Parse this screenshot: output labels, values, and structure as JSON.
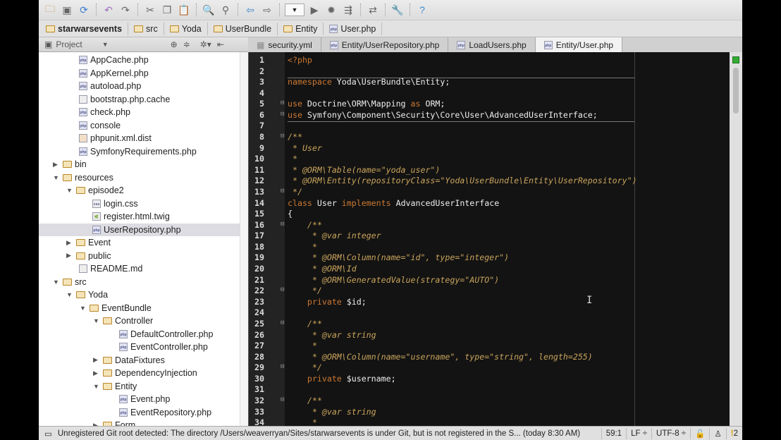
{
  "toolbar": {
    "icons": [
      "open-folder-icon",
      "save-icon",
      "sync-icon",
      "undo-icon",
      "redo-icon",
      "cut-icon",
      "copy-icon",
      "paste-icon",
      "find-icon",
      "replace-icon",
      "back-icon",
      "forward-icon",
      "run-config-dropdown",
      "run-icon",
      "debug-icon",
      "coverage-icon",
      "vcs-icon",
      "settings-icon",
      "help-icon"
    ]
  },
  "breadcrumb": [
    "starwarsevents",
    "src",
    "Yoda",
    "UserBundle",
    "Entity",
    "User.php"
  ],
  "project_panel": {
    "title": "Project"
  },
  "tabs": [
    {
      "label": "security.yml",
      "active": false
    },
    {
      "label": "Entity/UserRepository.php",
      "active": false
    },
    {
      "label": "LoadUsers.php",
      "active": false
    },
    {
      "label": "Entity/User.php",
      "active": true
    }
  ],
  "tree": [
    {
      "label": "AppCache.php",
      "level": 1,
      "type": "php"
    },
    {
      "label": "AppKernel.php",
      "level": 1,
      "type": "php"
    },
    {
      "label": "autoload.php",
      "level": 1,
      "type": "php"
    },
    {
      "label": "bootstrap.php.cache",
      "level": 1,
      "type": "file"
    },
    {
      "label": "check.php",
      "level": 1,
      "type": "php"
    },
    {
      "label": "console",
      "level": 1,
      "type": "php"
    },
    {
      "label": "phpunit.xml.dist",
      "level": 1,
      "type": "xml"
    },
    {
      "label": "SymfonyRequirements.php",
      "level": 1,
      "type": "php"
    },
    {
      "label": "bin",
      "level": 0,
      "type": "folder",
      "expanded": false
    },
    {
      "label": "resources",
      "level": 0,
      "type": "folder",
      "expanded": true
    },
    {
      "label": "episode2",
      "level": 1,
      "type": "folder",
      "expanded": true
    },
    {
      "label": "login.css",
      "level": 2,
      "type": "css"
    },
    {
      "label": "register.html.twig",
      "level": 2,
      "type": "twig"
    },
    {
      "label": "UserRepository.php",
      "level": 2,
      "type": "php",
      "selected": true
    },
    {
      "label": "Event",
      "level": 1,
      "type": "folder",
      "expanded": false
    },
    {
      "label": "public",
      "level": 1,
      "type": "folder",
      "expanded": false
    },
    {
      "label": "README.md",
      "level": 1,
      "type": "file"
    },
    {
      "label": "src",
      "level": 0,
      "type": "folder",
      "expanded": true
    },
    {
      "label": "Yoda",
      "level": 1,
      "type": "folder",
      "expanded": true
    },
    {
      "label": "EventBundle",
      "level": 2,
      "type": "folder",
      "expanded": true
    },
    {
      "label": "Controller",
      "level": 3,
      "type": "folder",
      "expanded": true
    },
    {
      "label": "DefaultController.php",
      "level": 4,
      "type": "php"
    },
    {
      "label": "EventController.php",
      "level": 4,
      "type": "php"
    },
    {
      "label": "DataFixtures",
      "level": 3,
      "type": "folder",
      "expanded": false
    },
    {
      "label": "DependencyInjection",
      "level": 3,
      "type": "folder",
      "expanded": false
    },
    {
      "label": "Entity",
      "level": 3,
      "type": "folder",
      "expanded": true
    },
    {
      "label": "Event.php",
      "level": 4,
      "type": "php"
    },
    {
      "label": "EventRepository.php",
      "level": 4,
      "type": "php"
    },
    {
      "label": "Form",
      "level": 3,
      "type": "folder",
      "expanded": false
    }
  ],
  "code": [
    [
      [
        "kw",
        "<?php"
      ]
    ],
    [],
    [
      [
        "kw",
        "namespace"
      ],
      [
        "tx",
        " Yoda\\UserBundle\\Entity;"
      ]
    ],
    [],
    [
      [
        "kw",
        "use"
      ],
      [
        "tx",
        " Doctrine\\ORM\\Mapping "
      ],
      [
        "kw",
        "as"
      ],
      [
        "tx",
        " ORM;"
      ]
    ],
    [
      [
        "kw",
        "use"
      ],
      [
        "tx",
        " Symfony\\Component\\Security\\Core\\User\\AdvancedUserInterface;"
      ]
    ],
    [],
    [
      [
        "dc",
        "/**"
      ]
    ],
    [
      [
        "dc",
        " * User"
      ]
    ],
    [
      [
        "dc",
        " *"
      ]
    ],
    [
      [
        "dc",
        " * @ORM\\Table(name=\"yoda_user\")"
      ]
    ],
    [
      [
        "dc",
        " * @ORM\\Entity(repositoryClass=\"Yoda\\UserBundle\\Entity\\UserRepository\")"
      ]
    ],
    [
      [
        "dc",
        " */"
      ]
    ],
    [
      [
        "kw",
        "class"
      ],
      [
        "tx",
        " User "
      ],
      [
        "kw",
        "implements"
      ],
      [
        "tx",
        " AdvancedUserInterface"
      ]
    ],
    [
      [
        "tx",
        "{"
      ]
    ],
    [
      [
        "dc",
        "    /**"
      ]
    ],
    [
      [
        "dc",
        "     * @var integer"
      ]
    ],
    [
      [
        "dc",
        "     *"
      ]
    ],
    [
      [
        "dc",
        "     * @ORM\\Column(name=\"id\", type=\"integer\")"
      ]
    ],
    [
      [
        "dc",
        "     * @ORM\\Id"
      ]
    ],
    [
      [
        "dc",
        "     * @ORM\\GeneratedValue(strategy=\"AUTO\")"
      ]
    ],
    [
      [
        "dc",
        "     */"
      ]
    ],
    [
      [
        "kw",
        "    private"
      ],
      [
        "tx",
        " $id;"
      ]
    ],
    [],
    [
      [
        "dc",
        "    /**"
      ]
    ],
    [
      [
        "dc",
        "     * @var string"
      ]
    ],
    [
      [
        "dc",
        "     *"
      ]
    ],
    [
      [
        "dc",
        "     * @ORM\\Column(name=\"username\", type=\"string\", length=255)"
      ]
    ],
    [
      [
        "dc",
        "     */"
      ]
    ],
    [
      [
        "kw",
        "    private"
      ],
      [
        "tx",
        " $username;"
      ]
    ],
    [],
    [
      [
        "dc",
        "    /**"
      ]
    ],
    [
      [
        "dc",
        "     * @var string"
      ]
    ],
    [
      [
        "dc",
        "     *"
      ]
    ]
  ],
  "status": {
    "message": "Unregistered Git root detected: The directory /Users/weaverryan/Sites/starwarsevents is under Git, but is not registered in the S... (today 8:30 AM)",
    "position": "59:1",
    "line_sep": "LF ÷",
    "encoding": "UTF-8 ÷",
    "notifications": "2"
  }
}
